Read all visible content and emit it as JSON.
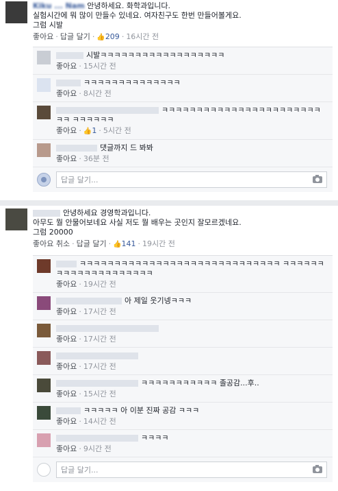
{
  "labels": {
    "like": "좋아요",
    "unlike": "좋아요 취소",
    "reply": "답글 달기",
    "write_reply": "답글 달기..."
  },
  "post1": {
    "author": "Kiku ... Nam",
    "lines": [
      "안녕하세요. 화학과입니다.",
      "실험시간에 뭐 많이 만들수 있네요. 여자친구도 한번 만들어볼게요.",
      "그럼 시발"
    ],
    "likes": "209",
    "time": "16시간 전",
    "replies": [
      {
        "text": "시발ㅋㅋㅋㅋㅋㅋㅋㅋㅋㅋㅋㅋㅋㅋㅋㅋㅋㅋ",
        "time": "15시간 전",
        "likes": "",
        "avatar": "#c9cdd4"
      },
      {
        "text": "ㅋㅋㅋㅋㅋㅋㅋㅋㅋㅋㅋㅋㅋㅋ",
        "time": "8시간 전",
        "likes": "",
        "avatar": "#dbe3f0"
      },
      {
        "text": "ㅋㅋㅋㅋㅋㅋㅋㅋㅋㅋㅋㅋㅋㅋㅋㅋㅋㅋㅋㅋㅋㅋㅋㅋㅋ ㅋㅋㅋㅋㅋㅋ",
        "time": "5시간 전",
        "likes": "1",
        "avatar": "#5a4a3a"
      },
      {
        "text": "댓글까지 드 봐봐",
        "time": "36분 전",
        "likes": "",
        "avatar": "#b89a8c"
      }
    ]
  },
  "post2": {
    "lines": [
      "안녕하세요 경영학과입니다.",
      "아무도 뭘 안물어보네요 사실 저도 뭘 배우는 곳인지 잘모르겠네요.",
      "그럼 20000"
    ],
    "likes": "141",
    "time": "19시간 전",
    "replies": [
      {
        "text": "ㅋㅋㅋㅋㅋㅋㅋㅋㅋㅋㅋㅋㅋㅋㅋㅋㅋㅋㅋㅋㅋㅋㅋㅋㅋㅋㅋㅋㅋ ㅋㅋㅋㅋㅋㅋㅋㅋㅋㅋㅋㅋㅋㅋㅋㅋㅋㅋㅋㅋ",
        "time": "19시간 전",
        "avatar": "#6e3a2a"
      },
      {
        "text": "아 제일 웃기넹ㅋㅋㅋ",
        "time": "17시간 전",
        "avatar": "#8a4a7a"
      },
      {
        "text": "",
        "time": "17시간 전",
        "avatar": "#7a5a3a"
      },
      {
        "text": "",
        "time": "17시간 전",
        "avatar": "#8a5a5a"
      },
      {
        "text": "ㅋㅋㅋㅋㅋㅋㅋㅋㅋㅋㅋ 졸공감...후..",
        "time": "15시간 전",
        "avatar": "#4a4a3a"
      },
      {
        "text": "ㅋㅋㅋㅋㅋ 아 이분 진짜 공감 ㅋㅋㅋ",
        "time": "14시간 전",
        "avatar": "#3a4a3a"
      },
      {
        "text": "ㅋㅋㅋㅋ",
        "time": "9시간 전",
        "avatar": "#d8a0b0"
      }
    ]
  }
}
